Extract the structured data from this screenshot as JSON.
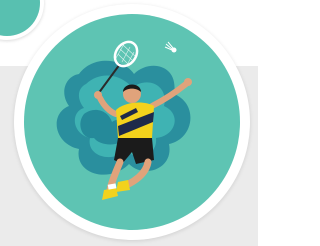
{
  "avatar": {
    "subject": "badminton-player",
    "colors": {
      "background": "#5ec4b3",
      "blob_dark": "#2a8f9e",
      "blob_light": "#3fb3b3",
      "shirt_yellow": "#f3d21c",
      "shirt_navy": "#1e2a4a",
      "shorts": "#1b1b1b",
      "skin": "#e0a37b",
      "hair": "#1a1a1a",
      "shoes": "#f3d21c"
    }
  },
  "corner_badge": {
    "color": "#58c0b0"
  }
}
